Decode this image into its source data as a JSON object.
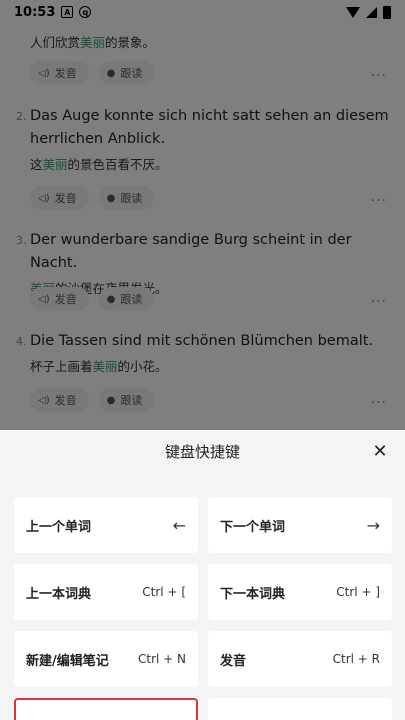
{
  "status_bar": {
    "time": "10:53"
  },
  "sentences": [
    {
      "num": "",
      "de": "",
      "zh_pre": "人们欣赏",
      "zh_hl": "美丽",
      "zh_post": "的景象。"
    },
    {
      "num": "2.",
      "de": "Das Auge konnte sich nicht satt sehen an diesem herrlichen Anblick.",
      "zh_pre": "这",
      "zh_hl": "美丽",
      "zh_post": "的景色百看不厌。"
    },
    {
      "num": "3.",
      "de": "Der wunderbare sandige Burg scheint in der Nacht.",
      "zh_pre": "",
      "zh_hl": "美丽",
      "zh_post": "的沙堡在夜里发光。"
    },
    {
      "num": "4.",
      "de": "Die Tassen sind mit schönen Blümchen bemalt.",
      "zh_pre": "杯子上画着",
      "zh_hl": "美丽",
      "zh_post": "的小花。"
    }
  ],
  "actions": {
    "pronounce": "发音",
    "read_along": "跟读",
    "more": "···"
  },
  "sheet": {
    "title": "键盘快捷键",
    "close_icon": "close-icon",
    "shortcuts": [
      {
        "label": "上一个单词",
        "key": "←"
      },
      {
        "label": "下一个单词",
        "key": "→"
      },
      {
        "label": "上一本词典",
        "key": "Ctrl + ["
      },
      {
        "label": "下一本词典",
        "key": "Ctrl + ]"
      },
      {
        "label": "新建/编辑笔记",
        "key": "Ctrl + N"
      },
      {
        "label": "发音",
        "key": "Ctrl + R"
      },
      {
        "label": "",
        "key": ""
      },
      {
        "label": "",
        "key": ""
      }
    ]
  },
  "colors": {
    "highlight": "#2d9c62",
    "focus_border": "#d9363e",
    "overlay": "rgba(0,0,0,0.5)"
  }
}
